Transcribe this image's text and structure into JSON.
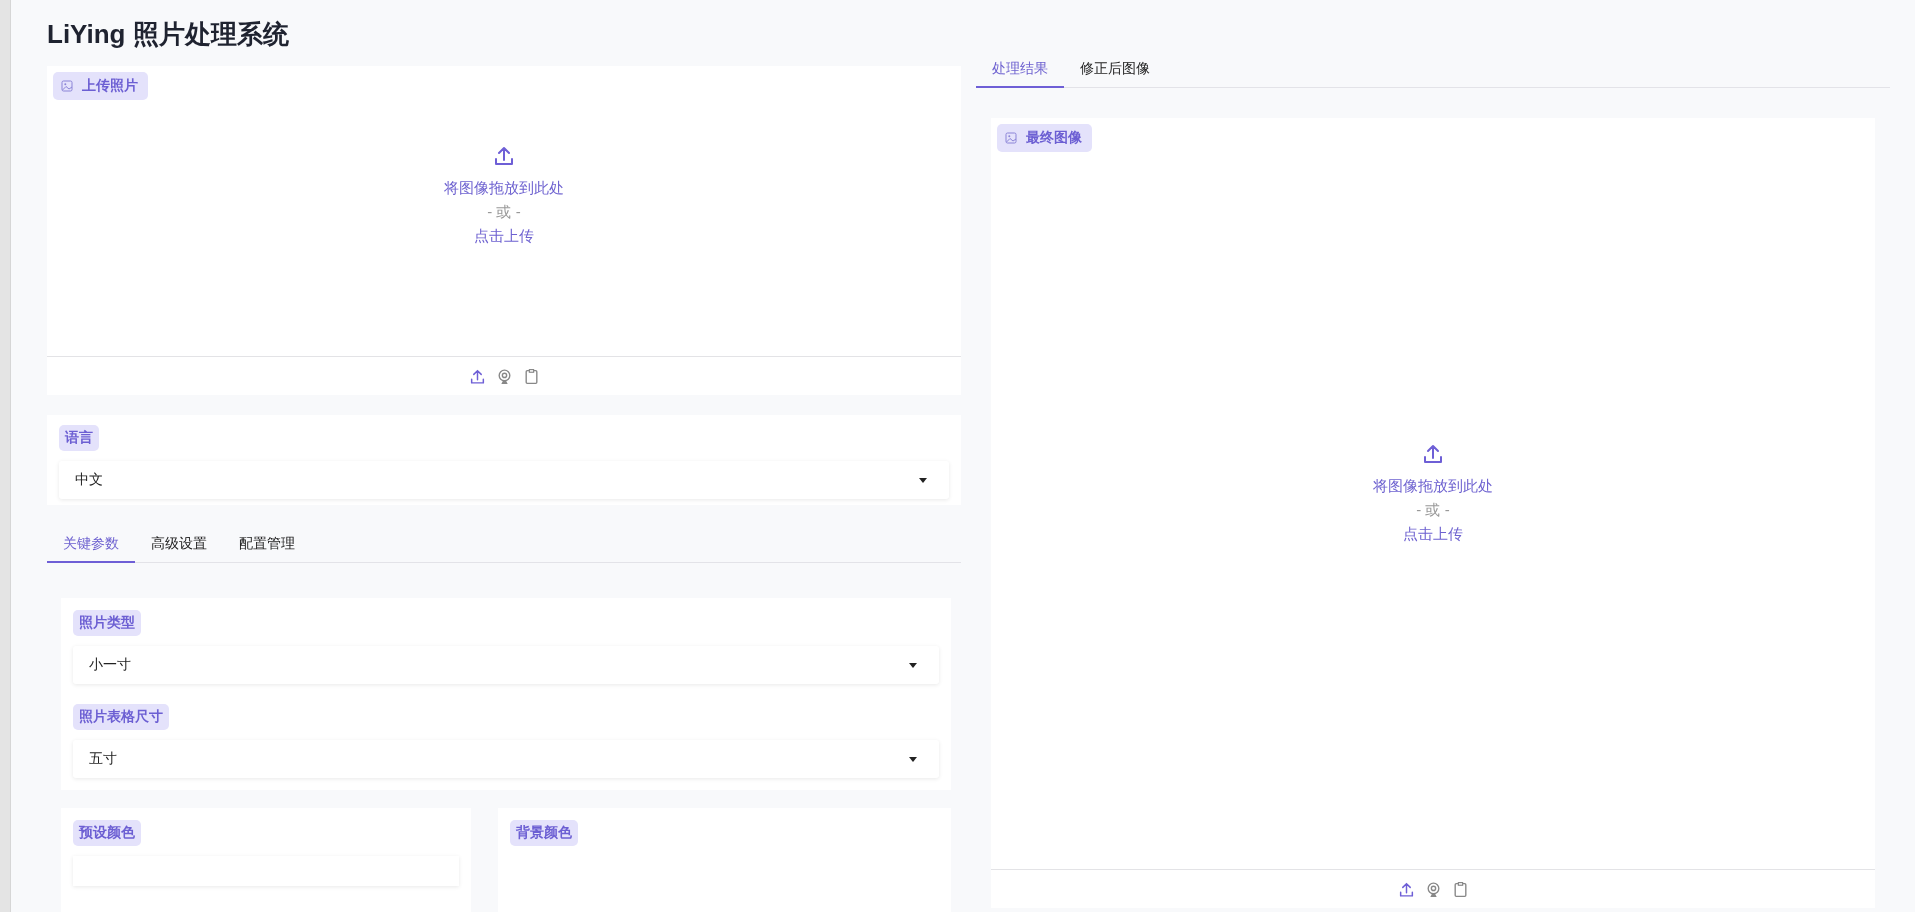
{
  "title": "LiYing 照片处理系统",
  "upload": {
    "label": "上传照片",
    "drop_text": "将图像拖放到此处",
    "or_text": "- 或 -",
    "click_text": "点击上传"
  },
  "language": {
    "label": "语言",
    "value": "中文"
  },
  "tabs": [
    {
      "label": "关键参数",
      "selected": true
    },
    {
      "label": "高级设置",
      "selected": false
    },
    {
      "label": "配置管理",
      "selected": false
    }
  ],
  "params": [
    {
      "label": "照片类型",
      "value": "小一寸"
    },
    {
      "label": "照片表格尺寸",
      "value": "五寸"
    }
  ],
  "colors": [
    {
      "label": "预设颜色"
    },
    {
      "label": "背景颜色"
    }
  ],
  "result_tabs": [
    {
      "label": "处理结果",
      "selected": true
    },
    {
      "label": "修正后图像",
      "selected": false
    }
  ],
  "result": {
    "label": "最终图像",
    "drop_text": "将图像拖放到此处",
    "or_text": "- 或 -",
    "click_text": "点击上传"
  }
}
